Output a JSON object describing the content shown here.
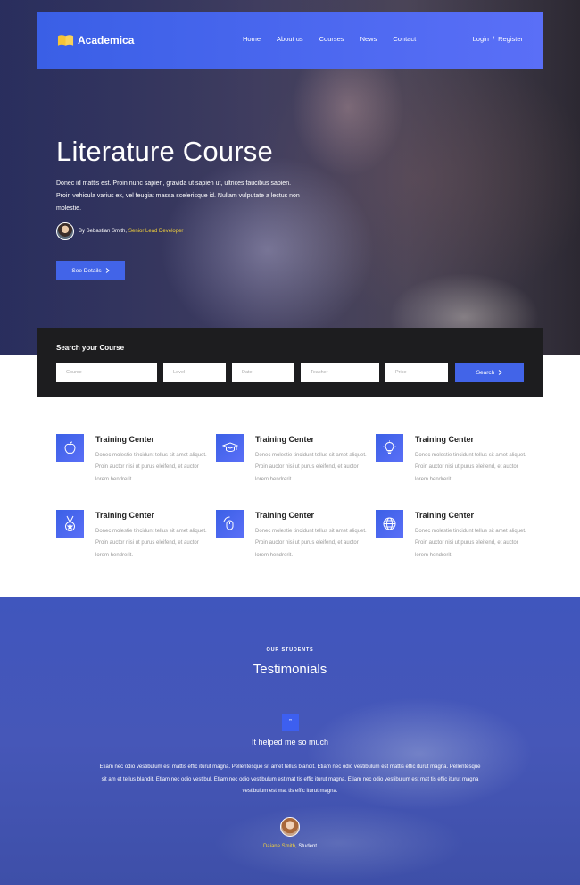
{
  "brand": {
    "name": "Academica",
    "accent": "#4264e8",
    "highlight": "#f4d23b"
  },
  "nav": {
    "links": [
      "Home",
      "About us",
      "Courses",
      "News",
      "Contact"
    ],
    "login": "Login",
    "separator": "/",
    "register": "Register"
  },
  "hero": {
    "title": "Literature Course",
    "description": "Donec id mattis est. Proin nunc sapien, gravida ut sapien ut, ultrices faucibus sapien. Proin vehicula varius ex, vel feugiat massa scelerisque id. Nullam vulputate a lectus non molestie.",
    "author_prefix": "By Sebastian Smith,",
    "author_role": "Senior Lead Developer",
    "cta": "See Details"
  },
  "search": {
    "title": "Search your Course",
    "fields": [
      "Course",
      "Level",
      "Date",
      "Teacher",
      "Price"
    ],
    "button": "Search"
  },
  "features": [
    {
      "icon": "apple-icon",
      "title": "Training Center",
      "text": "Donec molestie tincidunt tellus sit amet aliquet. Proin auctor nisi ut purus eleifend, et auctor lorem hendrerit."
    },
    {
      "icon": "graduation-cap-icon",
      "title": "Training Center",
      "text": "Donec molestie tincidunt tellus sit amet aliquet. Proin auctor nisi ut purus eleifend, et auctor lorem hendrerit."
    },
    {
      "icon": "lightbulb-icon",
      "title": "Training Center",
      "text": "Donec molestie tincidunt tellus sit amet aliquet. Proin auctor nisi ut purus eleifend, et auctor lorem hendrerit."
    },
    {
      "icon": "medal-icon",
      "title": "Training Center",
      "text": "Donec molestie tincidunt tellus sit amet aliquet. Proin auctor nisi ut purus eleifend, et auctor lorem hendrerit."
    },
    {
      "icon": "mouse-icon",
      "title": "Training Center",
      "text": "Donec molestie tincidunt tellus sit amet aliquet. Proin auctor nisi ut purus eleifend, et auctor lorem hendrerit."
    },
    {
      "icon": "globe-icon",
      "title": "Training Center",
      "text": "Donec molestie tincidunt tellus sit amet aliquet. Proin auctor nisi ut purus eleifend, et auctor lorem hendrerit."
    }
  ],
  "testimonials": {
    "label": "OUR STUDENTS",
    "title": "Testimonials",
    "quote_icon": "”",
    "heading": "It helped me so much",
    "body": "Etiam nec odio vestibulum est mattis effic iturut magna. Pellentesque sit amet tellus blandit. Etiam nec odio vestibulum est mattis effic iturut magna. Pellentesque sit am et tellus blandit. Etiam nec odio vestibul. Etiam nec odio vestibulum est mat tis effic iturut magna. Etiam nec odio vestibulum est mat tis effic iturut magna vestibulum est mat tis effic iturut magna.",
    "author_name": "Daiane Smith,",
    "author_role": "Student"
  }
}
